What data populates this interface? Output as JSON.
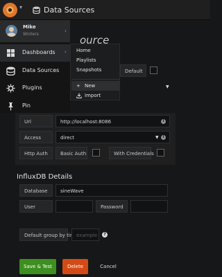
{
  "topbar": {
    "breadcrumb": "Data Sources",
    "icons": {
      "logo": "grafana-logo",
      "caret": "caret-down-icon",
      "crumb": "database-icon"
    }
  },
  "page": {
    "title_fragment": "ource",
    "default_label": "Default",
    "http": {
      "url_label": "Url",
      "url_value": "http://localhost:8086",
      "access_label": "Access",
      "access_value": "direct",
      "http_auth_label": "Http Auth",
      "basic_auth_label": "Basic Auth",
      "credentials_label": "With Credentials"
    },
    "influx": {
      "heading": "InfluxDB Details",
      "database_label": "Database",
      "database_value": "sineWave",
      "user_label": "User",
      "password_label": "Password"
    },
    "group_by": {
      "label": "Default group by time",
      "placeholder": "example"
    },
    "buttons": {
      "save": "Save & Test",
      "delete": "Delete",
      "cancel": "Cancel"
    }
  },
  "sidemenu": {
    "user": {
      "name": "Mike",
      "org": "Winters"
    },
    "items": [
      {
        "label": "Dashboards",
        "icon": "apps-icon"
      },
      {
        "label": "Data Sources",
        "icon": "database-icon"
      },
      {
        "label": "Plugins",
        "icon": "plug-icon"
      },
      {
        "label": "Pin",
        "icon": "pin-icon"
      }
    ],
    "submenu": {
      "items": [
        "Home",
        "Playlists",
        "Snapshots"
      ],
      "new_label": "New",
      "import_label": "Import"
    }
  },
  "colors": {
    "background": "#161719",
    "save": "#3d8f1f",
    "delete": "#d44a15",
    "logo": "#e0752d"
  }
}
